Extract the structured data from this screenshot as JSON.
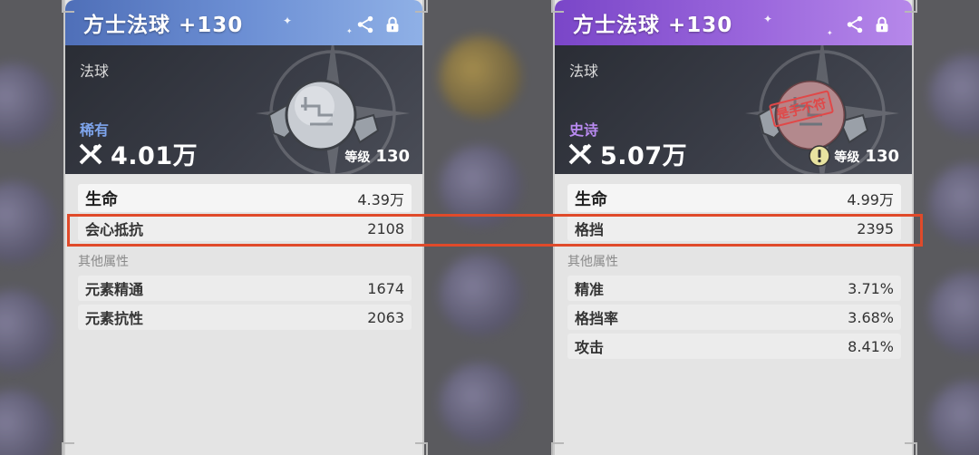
{
  "cards": [
    {
      "title": "方士法球 +130",
      "type": "法球",
      "rarity": "稀有",
      "power": "4.01万",
      "level_label": "等级",
      "level": "130",
      "stamp": "",
      "main_stats": [
        {
          "label": "生命",
          "value": "4.39万"
        },
        {
          "label": "会心抵抗",
          "value": "2108"
        }
      ],
      "other_label": "其他属性",
      "other_stats": [
        {
          "label": "元素精通",
          "value": "1674"
        },
        {
          "label": "元素抗性",
          "value": "2063"
        }
      ],
      "accent": "#6c8fd4"
    },
    {
      "title": "方士法球 +130",
      "type": "法球",
      "rarity": "史诗",
      "power": "5.07万",
      "level_label": "等级",
      "level": "130",
      "stamp": "是手不符",
      "main_stats": [
        {
          "label": "生命",
          "value": "4.99万"
        },
        {
          "label": "格挡",
          "value": "2395"
        }
      ],
      "other_label": "其他属性",
      "other_stats": [
        {
          "label": "精准",
          "value": "3.71%"
        },
        {
          "label": "格挡率",
          "value": "3.68%"
        },
        {
          "label": "攻击",
          "value": "8.41%"
        }
      ],
      "accent": "#9a66dc"
    }
  ],
  "icons": [
    "share-icon",
    "lock-icon",
    "power-icon",
    "warning-icon"
  ],
  "colors": {
    "highlight": "#e04a2a",
    "rare": "#7ea5ec",
    "epic": "#b98af0",
    "stamp": "#e04848"
  }
}
